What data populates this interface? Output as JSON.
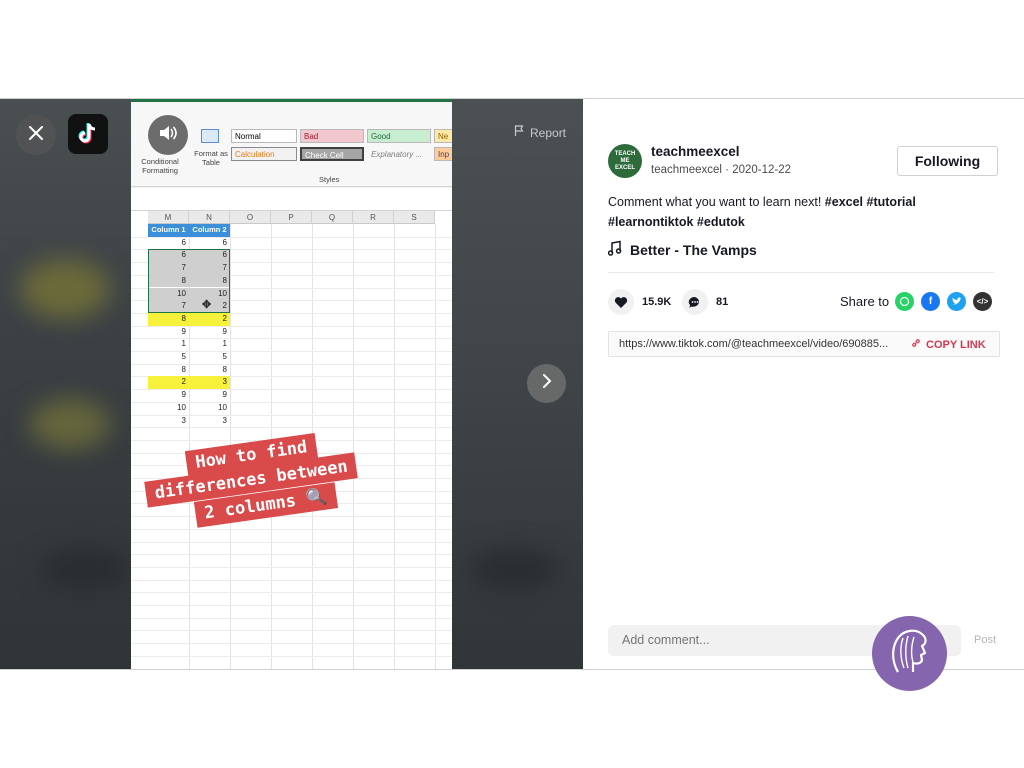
{
  "video": {
    "close_icon": "close-icon",
    "sound_icon": "speaker-icon",
    "report_label": "Report",
    "next_icon": "chevron-right-icon",
    "ribbon": {
      "conditional_formatting": "Conditional Formatting",
      "format_as_table": "Format as Table",
      "styles_label": "Styles",
      "normal": "Normal",
      "bad": "Bad",
      "good": "Good",
      "neutral": "Ne",
      "calculation": "Calculation",
      "check_cell": "Check Cell",
      "explanatory": "Explanatory ...",
      "input": "Inp"
    },
    "columns": [
      "M",
      "N",
      "O",
      "P",
      "Q",
      "R",
      "S"
    ],
    "table_headers": [
      "Column 1",
      "Column 2"
    ],
    "column1": [
      "6",
      "6",
      "7",
      "8",
      "10",
      "7",
      "8",
      "9",
      "1",
      "5",
      "8",
      "2",
      "9",
      "10",
      "3"
    ],
    "column2": [
      "6",
      "6",
      "7",
      "8",
      "10",
      "2",
      "2",
      "9",
      "1",
      "5",
      "8",
      "3",
      "9",
      "10",
      "3"
    ],
    "overlay_lines": [
      "How to find",
      "differences between",
      "2 columns 🔍"
    ]
  },
  "colors": {
    "highlight": "#f6f13a",
    "selected": "#cfcfcf",
    "overlay": "#d94b4b",
    "brand_red": "#d43a50"
  },
  "post": {
    "username": "teachmeexcel",
    "handle": "teachmeexcel",
    "date": "2020-12-22",
    "avatar_text": "TEACH ME EXCEL",
    "follow_label": "Following",
    "description_text": "Comment what you want to learn next!",
    "hashtags": [
      "#excel",
      "#tutorial",
      "#learnontiktok",
      "#edutok"
    ],
    "music": "Better - The Vamps",
    "likes": "15.9K",
    "comments": "81",
    "share_label": "Share to",
    "share_icons": [
      "whatsapp-icon",
      "facebook-icon",
      "twitter-icon",
      "embed-icon"
    ],
    "link_url": "https://www.tiktok.com/@teachmeexcel/video/690885...",
    "copy_link_label": "COPY LINK",
    "comment_placeholder": "Add comment...",
    "post_label": "Post"
  }
}
